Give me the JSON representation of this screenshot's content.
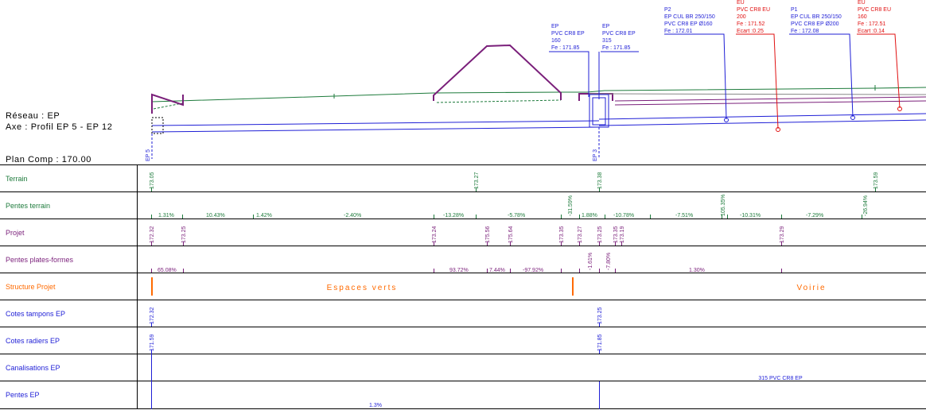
{
  "header": {
    "reseau": "Réseau : EP",
    "axe": "Axe : Profil EP 5 - EP 12",
    "plan_comp": "Plan Comp : 170.00"
  },
  "colors": {
    "terrain": "#1e7b3c",
    "projet": "#7a1f7a",
    "network": "#1f1fd6",
    "eu": "#e01010",
    "structure": "#ff6a00",
    "grid": "#000000"
  },
  "top_labels": {
    "ep5": "EP 5",
    "ep3": "EP 3",
    "ep_160": [
      "EP",
      "PVC CR8 EP",
      "160",
      "Fe : 171.85"
    ],
    "ep_315": [
      "EP",
      "PVC CR8 EP",
      "315",
      "Fe : 171.85"
    ],
    "p2": [
      "P2",
      "EP CUL BR 250/150",
      "PVC CR8 EP Ø160",
      "Fe : 172.01"
    ],
    "eu_200": [
      "EU",
      "PVC CR8 EU",
      "200",
      "Fe : 171.52",
      "Ecart :0.25"
    ],
    "p1": [
      "P1",
      "EP CUL BR 250/150",
      "PVC CR8 EP Ø200",
      "Fe : 172.08"
    ],
    "eu_160": [
      "EU",
      "PVC CR8 EU",
      "160",
      "Fe : 172.51",
      "Ecart :0.14"
    ]
  },
  "rows": [
    {
      "label": "Terrain",
      "color": "#1e7b3c"
    },
    {
      "label": "Pentes terrain",
      "color": "#1e7b3c"
    },
    {
      "label": "Projet",
      "color": "#7a1f7a"
    },
    {
      "label": "Pentes plates-formes",
      "color": "#7a1f7a"
    },
    {
      "label": "Structure Projet",
      "color": "#ff6a00"
    },
    {
      "label": "Cotes tampons  EP",
      "color": "#1f1fd6"
    },
    {
      "label": "Cotes radiers  EP",
      "color": "#1f1fd6"
    },
    {
      "label": "Canalisations  EP",
      "color": "#1f1fd6"
    },
    {
      "label": "Pentes  EP",
      "color": "#1f1fd6"
    }
  ],
  "terrain_values": [
    "173.05",
    "173.27",
    "173.38",
    "173.59"
  ],
  "pentes_terrain": [
    "1.31%",
    "10.43%",
    "1.42%",
    "-2.40%",
    "-13.28%",
    "-5.78%",
    "-31.59%",
    "1.88%",
    "-10.78%",
    "-7.51%",
    "105.35%",
    "-10.31%",
    "-7.29%",
    "-26.94%"
  ],
  "projet_values": [
    "172.32",
    "173.25",
    "173.24",
    "175.56",
    "175.64",
    "173.35",
    "173.27",
    "173.25",
    "173.35",
    "173.19",
    "173.29"
  ],
  "pentes_pf": [
    "65.08%",
    "93.72%",
    "7.44%",
    "-97.92%",
    "-1.61%",
    "-7.80%",
    "1.30%"
  ],
  "structure": [
    "Espaces verts",
    "Voirie"
  ],
  "cotes_tampons": [
    "172.32",
    "173.25"
  ],
  "cotes_radiers": [
    "171.59",
    "171.85"
  ],
  "canalisation": "315 PVC CR8 EP",
  "pentes_ep": "1.3%"
}
